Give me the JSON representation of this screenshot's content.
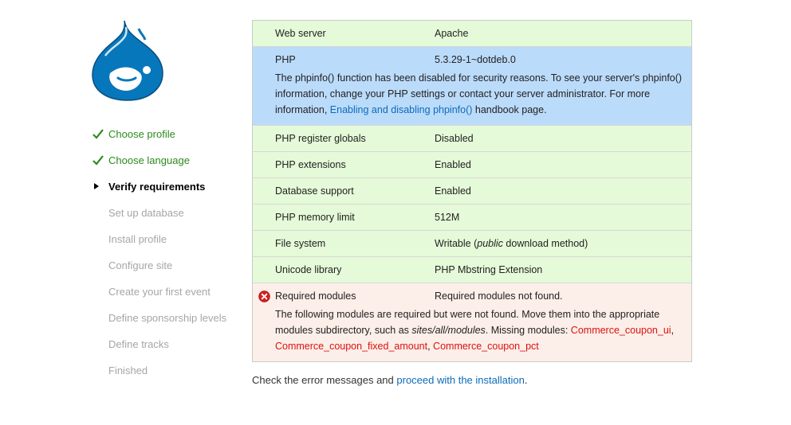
{
  "logo": {
    "icon": "drupal-drop-logo",
    "color": "#0777bb"
  },
  "steps": [
    {
      "label": "Choose profile",
      "state": "done"
    },
    {
      "label": "Choose language",
      "state": "done"
    },
    {
      "label": "Verify requirements",
      "state": "active"
    },
    {
      "label": "Set up database",
      "state": "pending"
    },
    {
      "label": "Install profile",
      "state": "pending"
    },
    {
      "label": "Configure site",
      "state": "pending"
    },
    {
      "label": "Create your first event",
      "state": "pending"
    },
    {
      "label": "Define sponsorship levels",
      "state": "pending"
    },
    {
      "label": "Define tracks",
      "state": "pending"
    },
    {
      "label": "Finished",
      "state": "pending"
    }
  ],
  "requirements": {
    "web_server": {
      "title": "Web server",
      "value": "Apache"
    },
    "php": {
      "title": "PHP",
      "value": "5.3.29-1~dotdeb.0",
      "desc_pre": "The phpinfo() function has been disabled for security reasons. To see your server's phpinfo() information, change your PHP settings or contact your server administrator. For more information,",
      "desc_link": "Enabling and disabling phpinfo()",
      "desc_post": "handbook page."
    },
    "register_globals": {
      "title": "PHP register globals",
      "value": "Disabled"
    },
    "extensions": {
      "title": "PHP extensions",
      "value": "Enabled"
    },
    "database": {
      "title": "Database support",
      "value": "Enabled"
    },
    "memory": {
      "title": "PHP memory limit",
      "value": "512M"
    },
    "file_system": {
      "title": "File system",
      "value_pre": "Writable (",
      "value_em": "public",
      "value_post": "download method)"
    },
    "unicode": {
      "title": "Unicode library",
      "value": "PHP Mbstring Extension"
    },
    "modules": {
      "title": "Required modules",
      "value": "Required modules not found.",
      "desc_pre": "The following modules are required but were not found. Move them into the appropriate modules subdirectory, such as",
      "desc_path": "sites/all/modules",
      "desc_mid": ". Missing modules:",
      "missing": [
        "Commerce_coupon_ui",
        "Commerce_coupon_fixed_amount",
        "Commerce_coupon_pct"
      ],
      "icon": "error-icon"
    }
  },
  "footer": {
    "pre": "Check the error messages and",
    "link": "proceed with the installation",
    "post": "."
  },
  "colors": {
    "ok_row": "#e5fad8",
    "info_row": "#bbdbfb",
    "error_row": "#fceee8",
    "done_step": "#2c8a1c",
    "pending_step": "#a6a6a6",
    "link": "#0c6bb8",
    "error_text": "#dd1111"
  }
}
